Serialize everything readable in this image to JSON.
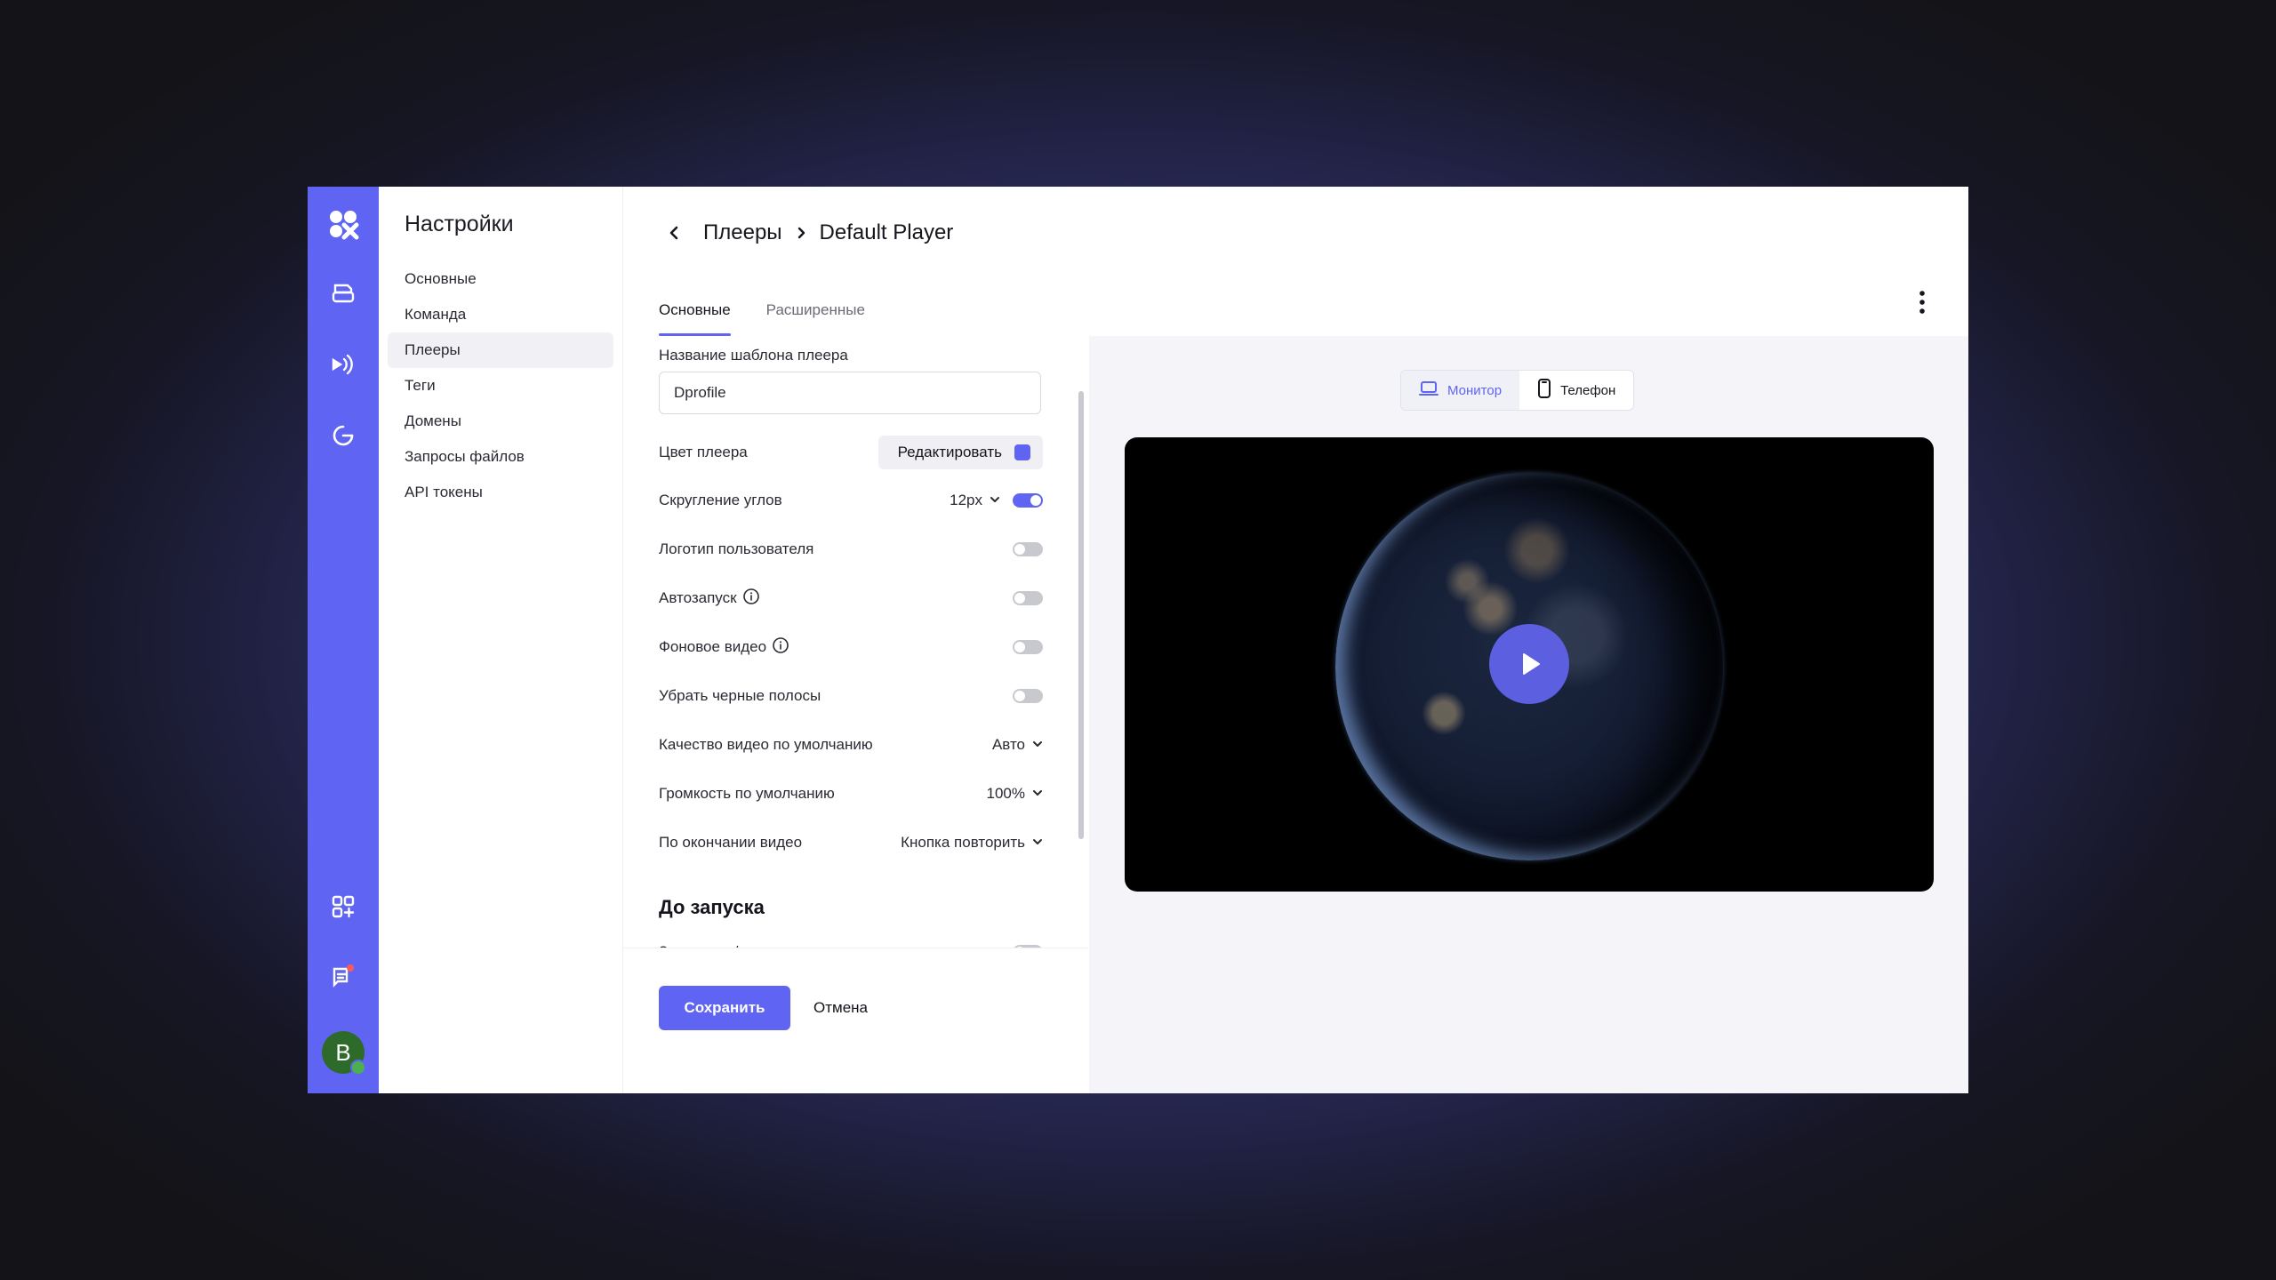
{
  "settings_title": "Настройки",
  "nav": [
    "Основные",
    "Команда",
    "Плееры",
    "Теги",
    "Домены",
    "Запросы файлов",
    "API токены"
  ],
  "active_nav": "Плееры",
  "avatar_letter": "B",
  "breadcrumb": {
    "parent": "Плееры",
    "current": "Default Player"
  },
  "tabs": [
    {
      "label": "Основные",
      "active": true
    },
    {
      "label": "Расширенные",
      "active": false
    }
  ],
  "form": {
    "template_name_label": "Название шаблона плеера",
    "template_name_value": "Dprofile",
    "player_color_label": "Цвет плеера",
    "edit_button": "Редактировать",
    "player_color": "#5f64f3",
    "rounding_label": "Скругление углов",
    "rounding_value": "12px",
    "rounding_enabled": true,
    "user_logo_label": "Логотип пользователя",
    "user_logo_enabled": false,
    "autoplay_label": "Автозапуск",
    "autoplay_enabled": false,
    "background_video_label": "Фоновое видео",
    "background_video_enabled": false,
    "black_bars_label": "Убрать черные полосы",
    "black_bars_enabled": false,
    "quality_label": "Качество видео по умолчанию",
    "quality_value": "Авто",
    "volume_label": "Громкость по умолчанию",
    "volume_value": "100%",
    "end_label": "По окончании видео",
    "end_value": "Кнопка повторить",
    "before_start_heading": "До запуска",
    "title_subtitle_label": "Заголовок / подзаголовок",
    "title_subtitle_enabled": false
  },
  "actions": {
    "save": "Сохранить",
    "cancel": "Отмена"
  },
  "preview": {
    "devices": [
      {
        "label": "Монитор",
        "icon": "monitor-icon",
        "active": true
      },
      {
        "label": "Телефон",
        "icon": "phone-icon",
        "active": false
      }
    ]
  },
  "colors": {
    "accent": "#5f64f3",
    "rail": "#5f64f3"
  }
}
